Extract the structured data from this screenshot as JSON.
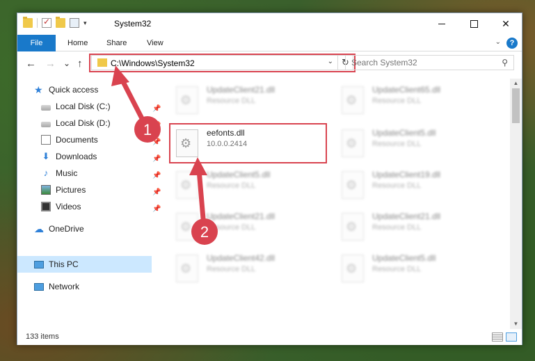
{
  "window": {
    "title": "System32",
    "controls": {
      "close": "✕"
    }
  },
  "ribbon": {
    "tabs": [
      {
        "label": "File"
      },
      {
        "label": "Home"
      },
      {
        "label": "Share"
      },
      {
        "label": "View"
      }
    ],
    "help": "?"
  },
  "navigation": {
    "address": "C:\\Windows\\System32",
    "search_placeholder": "Search System32",
    "back": "←",
    "forward": "→",
    "up": "↑",
    "recent": "⌄",
    "refresh": "↻",
    "dropdown": "⌄"
  },
  "sidebar": {
    "items": [
      {
        "label": "Quick access",
        "icon": "star-icon"
      },
      {
        "label": "Local Disk (C:)",
        "icon": "drive-icon",
        "pinned": true
      },
      {
        "label": "Local Disk (D:)",
        "icon": "drive-icon",
        "pinned": true
      },
      {
        "label": "Documents",
        "icon": "documents-icon",
        "pinned": true
      },
      {
        "label": "Downloads",
        "icon": "download-icon",
        "pinned": true
      },
      {
        "label": "Music",
        "icon": "music-icon",
        "pinned": true
      },
      {
        "label": "Pictures",
        "icon": "pictures-icon",
        "pinned": true
      },
      {
        "label": "Videos",
        "icon": "videos-icon",
        "pinned": true
      },
      {
        "label": "OneDrive",
        "icon": "cloud-icon"
      },
      {
        "label": "This PC",
        "icon": "computer-icon",
        "selected": true
      },
      {
        "label": "Network",
        "icon": "network-icon"
      }
    ]
  },
  "files": [
    {
      "name": "UpdateClient21.dll",
      "desc": "Resource DLL"
    },
    {
      "name": "UpdateClient65.dll",
      "desc": "Resource DLL"
    },
    {
      "name": "eefonts.dll",
      "desc": "10.0.0.2414"
    },
    {
      "name": "UpdateClient5.dll",
      "desc": "Resource DLL"
    },
    {
      "name": "UpdateClient5.dll",
      "desc": "Resource DLL"
    },
    {
      "name": "UpdateClient19.dll",
      "desc": "Resource DLL"
    },
    {
      "name": "UpdateClient21.dll",
      "desc": "Resource DLL"
    },
    {
      "name": "UpdateClient21.dll",
      "desc": "Resource DLL"
    },
    {
      "name": "UpdateClient42.dll",
      "desc": "Resource DLL"
    },
    {
      "name": "UpdateClient5.dll",
      "desc": "Resource DLL"
    }
  ],
  "status": {
    "item_count": "133 items"
  },
  "annotations": {
    "marker1": "1",
    "marker2": "2",
    "color": "#d9434f"
  }
}
